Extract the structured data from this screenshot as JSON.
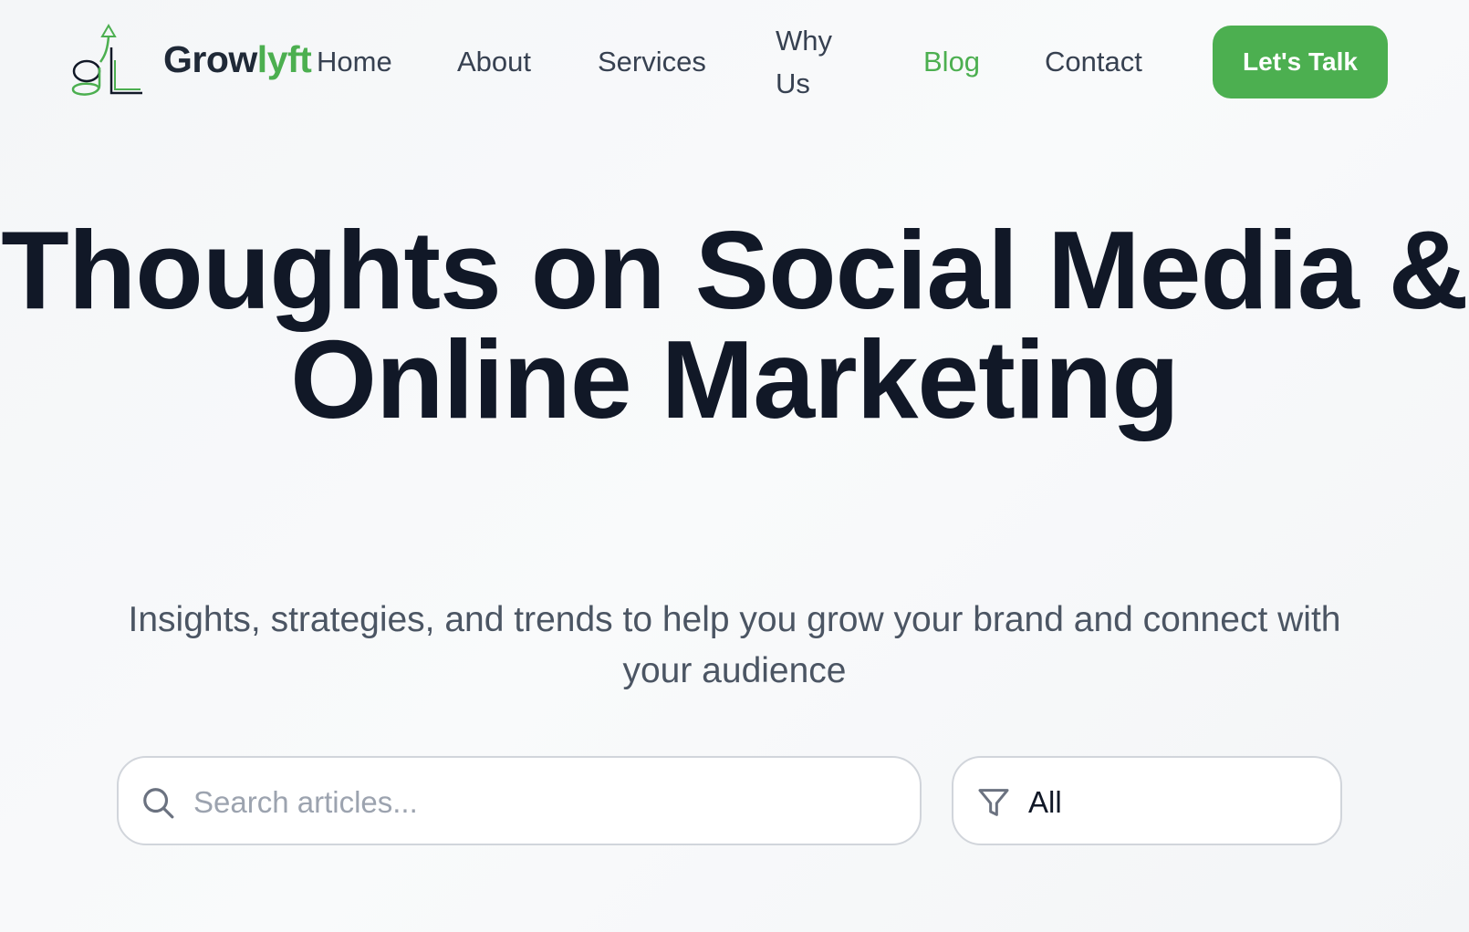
{
  "brand": {
    "name_part1": "Grow",
    "name_part2": "lyft",
    "logo_letters": "gL"
  },
  "nav": {
    "items": [
      {
        "label": "Home",
        "active": false
      },
      {
        "label": "About",
        "active": false
      },
      {
        "label": "Services",
        "active": false
      },
      {
        "label": "Why Us",
        "active": false
      },
      {
        "label": "Blog",
        "active": true
      },
      {
        "label": "Contact",
        "active": false
      }
    ],
    "cta_label": "Let's Talk"
  },
  "hero": {
    "title": "Thoughts on Social Media & Online Marketing",
    "subtitle": "Insights, strategies, and trends to help you grow your brand and connect with your audience"
  },
  "search": {
    "placeholder": "Search articles...",
    "value": "",
    "icon": "search-icon"
  },
  "filter": {
    "value": "All",
    "icon": "filter-icon"
  },
  "colors": {
    "accent": "#4caf50",
    "text_dark": "#111827",
    "text_muted": "#4b5563",
    "border": "#d1d5db"
  }
}
